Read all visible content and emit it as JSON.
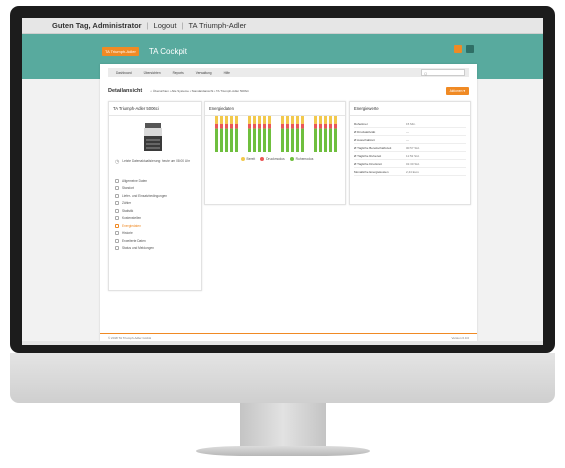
{
  "greeting": {
    "text": "Guten Tag, Administrator",
    "logout": "Logout",
    "company": "TA Triumph-Adler"
  },
  "brand": {
    "logo": "TA Triumph-Adler",
    "product": "TA Cockpit",
    "accent": "#f08a24",
    "header_color": "#58aa9e"
  },
  "nav": {
    "items": [
      "Dashboard",
      "Übersichten",
      "Reports",
      "Verwaltung",
      "Hilfe"
    ],
    "search_placeholder": "Q"
  },
  "page": {
    "title": "Detailansicht",
    "breadcrumb": "Übersichten • Alle Systeme • Standardansicht • TA Triumph-Adler 5006ci",
    "action_button": "Aktionen"
  },
  "device_panel": {
    "title": "TA Triumph-Adler 5006ci",
    "status": "Letzte Datenaktualisierung: heute um 08:00 Uhr",
    "menu": [
      {
        "label": "Allgemeine Daten",
        "icon": "info-icon",
        "active": false
      },
      {
        "label": "Standort",
        "icon": "location-icon",
        "active": false
      },
      {
        "label": "Liefer- und Einsatzbedingungen",
        "icon": "truck-icon",
        "active": false
      },
      {
        "label": "Zähler",
        "icon": "counter-icon",
        "active": false
      },
      {
        "label": "Statistik",
        "icon": "statistics-icon",
        "active": false
      },
      {
        "label": "Kostenstellen",
        "icon": "cost-center-icon",
        "active": false
      },
      {
        "label": "Energiedaten",
        "icon": "energy-icon",
        "active": true
      },
      {
        "label": "Historie",
        "icon": "history-icon",
        "active": false
      },
      {
        "label": "Erweiterte Daten",
        "icon": "extended-data-icon",
        "active": false
      },
      {
        "label": "Status und Meldungen",
        "icon": "status-icon",
        "active": false
      }
    ]
  },
  "energy_panel": {
    "title": "Energiedaten",
    "legend": [
      {
        "label": "Bereit",
        "color": "#f2c94c"
      },
      {
        "label": "Druckmodus",
        "color": "#eb5757"
      },
      {
        "label": "Ruhemodus",
        "color": "#6fbf3e"
      }
    ]
  },
  "values_panel": {
    "title": "Energiewerte",
    "rows": [
      {
        "label": "Ruhetimer",
        "value": "15 Min."
      },
      {
        "label": "Ø Druckaktivität",
        "value": "---"
      },
      {
        "label": "Ø Ausschaltzeit",
        "value": "---"
      },
      {
        "label": "Ø Tägliche Bereitschaftszeit",
        "value": "00:57 Std."
      },
      {
        "label": "Ø Tägliche Ruhezeit",
        "value": "11:52 Std."
      },
      {
        "label": "Ø Tägliche Druckzeit",
        "value": "01:30 Std."
      },
      {
        "label": "Monatliche Energiekosten",
        "value": "2,44 Euro"
      }
    ]
  },
  "footer": {
    "left": "© 2018 TA Triumph-Adler GmbH",
    "right": "Version 6.0.0"
  }
}
